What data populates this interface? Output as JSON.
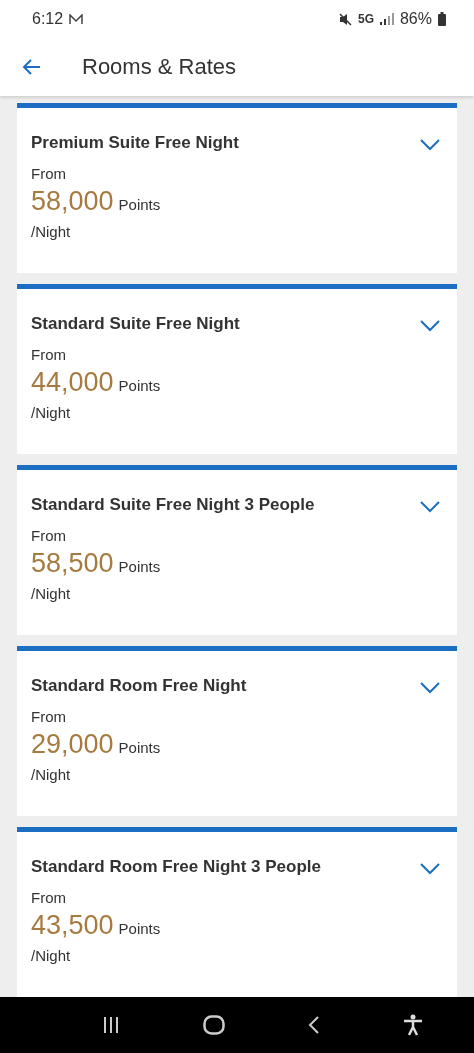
{
  "status_bar": {
    "time": "6:12",
    "network": "5G",
    "battery": "86%"
  },
  "app_bar": {
    "title": "Rooms & Rates"
  },
  "rooms": [
    {
      "name": "Premium Suite Free Night",
      "from": "From",
      "points": "58,000",
      "unit": "Points",
      "per": "/Night",
      "expanded": false
    },
    {
      "name": "Standard Suite Free Night",
      "from": "From",
      "points": "44,000",
      "unit": "Points",
      "per": "/Night",
      "expanded": false
    },
    {
      "name": "Standard Suite Free Night 3 People",
      "from": "From",
      "points": "58,500",
      "unit": "Points",
      "per": "/Night",
      "expanded": false
    },
    {
      "name": "Standard Room Free Night",
      "from": "From",
      "points": "29,000",
      "unit": "Points",
      "per": "/Night",
      "expanded": false
    },
    {
      "name": "Standard Room Free Night 3 People",
      "from": "From",
      "points": "43,500",
      "unit": "Points",
      "per": "/Night",
      "expanded": false
    }
  ]
}
